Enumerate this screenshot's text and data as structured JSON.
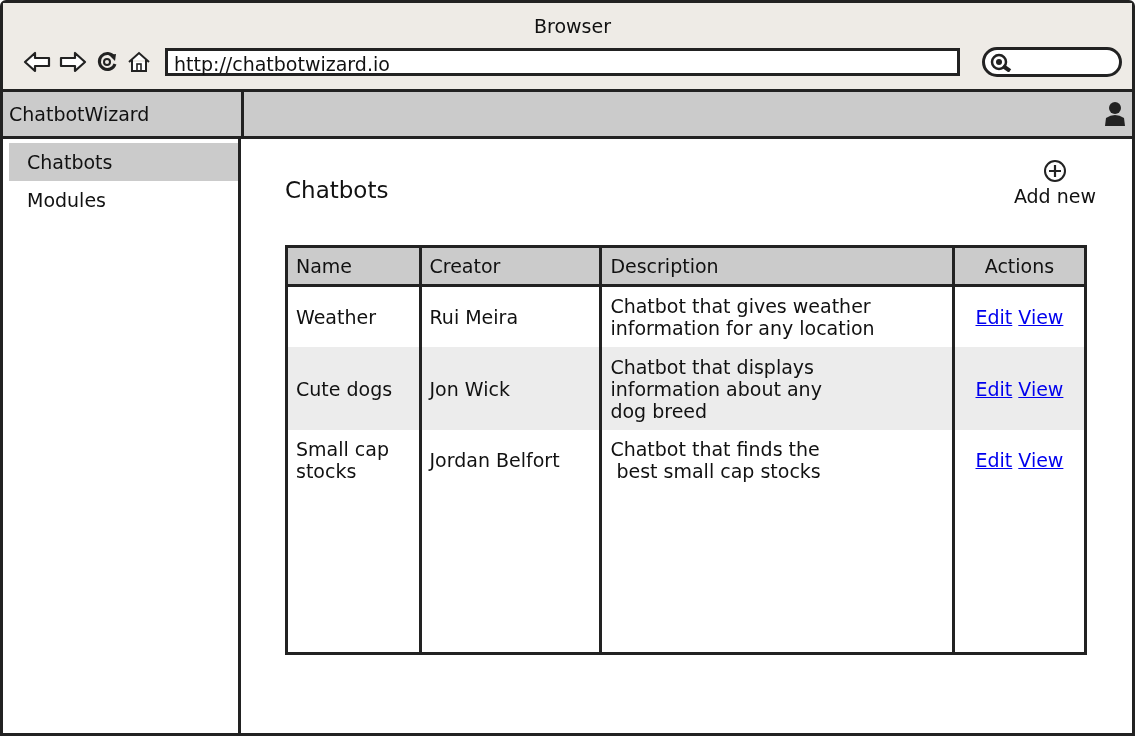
{
  "window": {
    "title": "Browser"
  },
  "browser": {
    "url": "http://chatbotwizard.io"
  },
  "app": {
    "brand": "ChatbotWizard"
  },
  "sidebar": {
    "items": [
      {
        "label": "Chatbots",
        "selected": true
      },
      {
        "label": "Modules",
        "selected": false
      }
    ]
  },
  "page": {
    "heading": "Chatbots",
    "add_button": "Add new"
  },
  "table": {
    "columns": [
      "Name",
      "Creator",
      "Description",
      "Actions"
    ],
    "rows": [
      {
        "name": "Weather",
        "creator": "Rui Meira",
        "description": "Chatbot that gives weather\ninformation for any location",
        "actions": [
          "Edit",
          "View"
        ]
      },
      {
        "name": "Cute dogs",
        "creator": "Jon Wick",
        "description": "Chatbot that displays\ninformation about any\ndog breed",
        "actions": [
          "Edit",
          "View"
        ]
      },
      {
        "name": "Small cap\nstocks",
        "creator": "Jordan Belfort",
        "description": "Chatbot that finds the\n best small cap stocks",
        "actions": [
          "Edit",
          "View"
        ]
      }
    ]
  }
}
